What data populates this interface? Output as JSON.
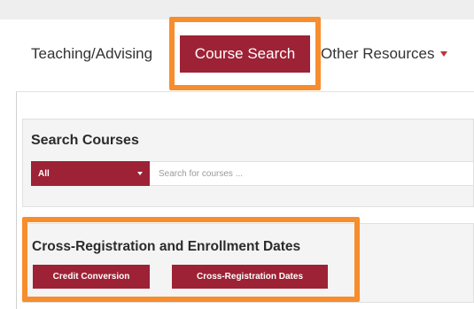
{
  "nav": {
    "items": [
      {
        "label": "Teaching/Advising"
      },
      {
        "label": "Course Search"
      },
      {
        "label": "Other Resources"
      }
    ]
  },
  "search_panel": {
    "title": "Search Courses",
    "select_value": "All",
    "input_placeholder": "Search for courses ..."
  },
  "cross_panel": {
    "title": "Cross-Registration and Enrollment Dates",
    "buttons": [
      {
        "label": "Credit Conversion"
      },
      {
        "label": "Cross-Registration Dates"
      }
    ]
  },
  "colors": {
    "brand": "#9d2235",
    "highlight": "#f78d2c",
    "panel_bg": "#f4f4f4"
  }
}
